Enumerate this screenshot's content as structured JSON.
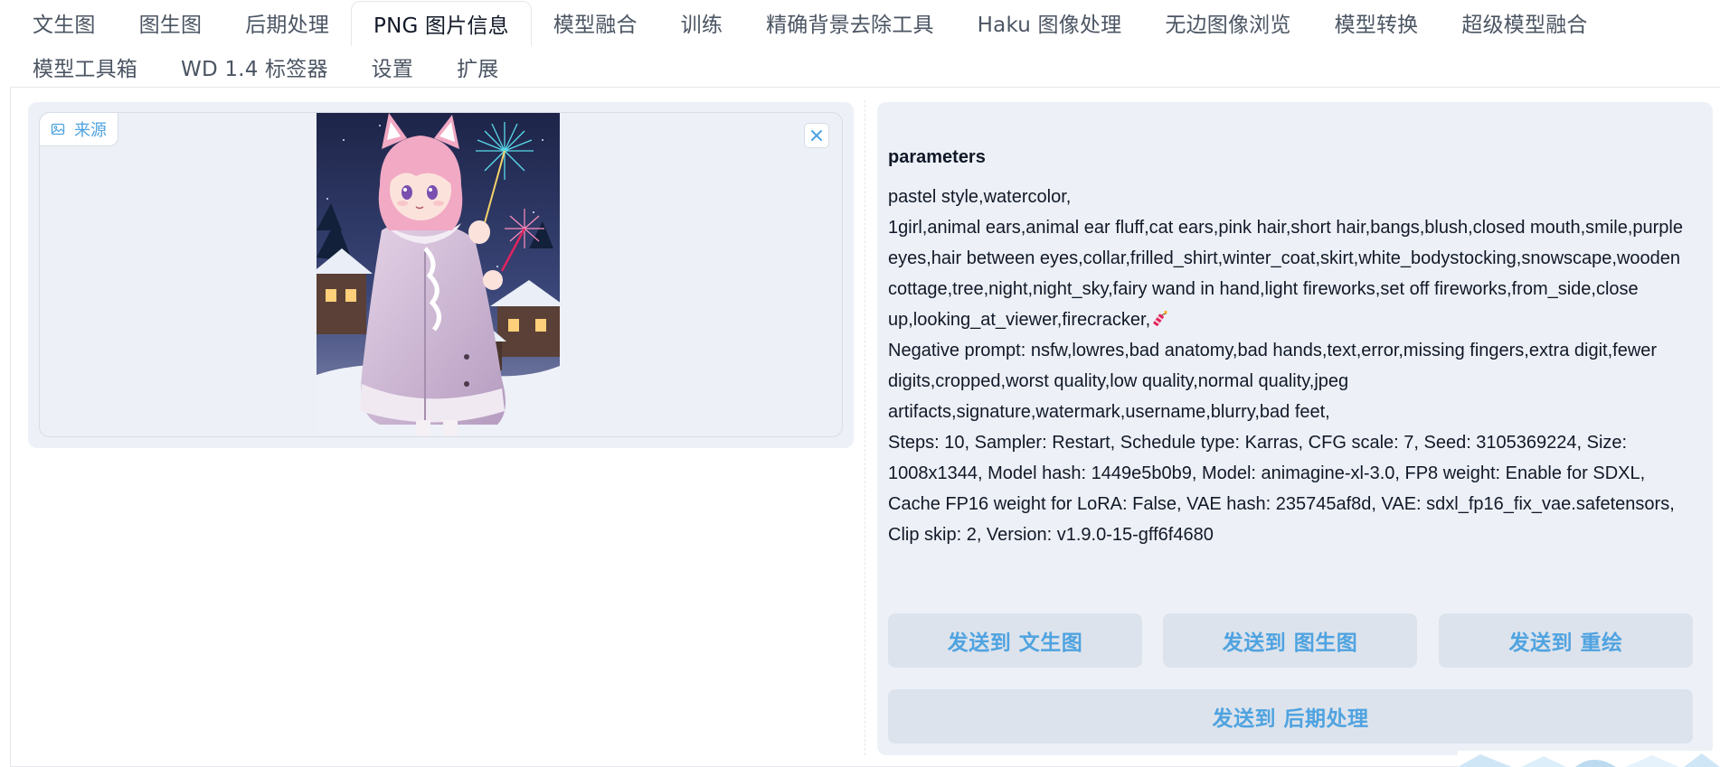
{
  "tabs": {
    "row1": [
      "文生图",
      "图生图",
      "后期处理",
      "PNG 图片信息",
      "模型融合",
      "训练",
      "精确背景去除工具",
      "Haku 图像处理",
      "无边图像浏览",
      "模型转换",
      "超级模型融合"
    ],
    "row2": [
      "模型工具箱",
      "WD 1.4 标签器",
      "设置",
      "扩展"
    ],
    "active": "PNG 图片信息"
  },
  "image_panel": {
    "source_label": "来源",
    "close_icon": "close-icon",
    "image_icon": "image-icon"
  },
  "info": {
    "label": "parameters",
    "lines": [
      "pastel style,watercolor,",
      "1girl,animal ears,animal ear fluff,cat ears,pink hair,short hair,bangs,blush,closed mouth,smile,purple eyes,hair between eyes,collar,frilled_shirt,winter_coat,skirt,white_bodystocking,snowscape,wooden cottage,tree,night,night_sky,fairy wand in hand,light fireworks,set off fireworks,from_side,close up,looking_at_viewer,firecracker,",
      "Negative prompt: nsfw,lowres,bad anatomy,bad hands,text,error,missing fingers,extra digit,fewer digits,cropped,worst quality,low quality,normal quality,jpeg artifacts,signature,watermark,username,blurry,bad feet,",
      "Steps: 10, Sampler: Restart, Schedule type: Karras, CFG scale: 7, Seed: 3105369224, Size: 1008x1344, Model hash: 1449e5b0b9, Model: animagine-xl-3.0, FP8 weight: Enable for SDXL, Cache FP16 weight for LoRA: False, VAE hash: 235745af8d, VAE: sdxl_fp16_fix_vae.safetensors, Clip skip: 2, Version: v1.9.0-15-gff6f4680"
    ],
    "firecracker_icon": "firecracker-icon"
  },
  "buttons": {
    "send_txt2img": "发送到 文生图",
    "send_img2img": "发送到 图生图",
    "send_inpaint": "发送到 重绘",
    "send_extras": "发送到 后期处理"
  },
  "colors": {
    "accent": "#4fa3e0",
    "panel_bg": "#edf1f7",
    "button_bg": "#dde3ec"
  }
}
